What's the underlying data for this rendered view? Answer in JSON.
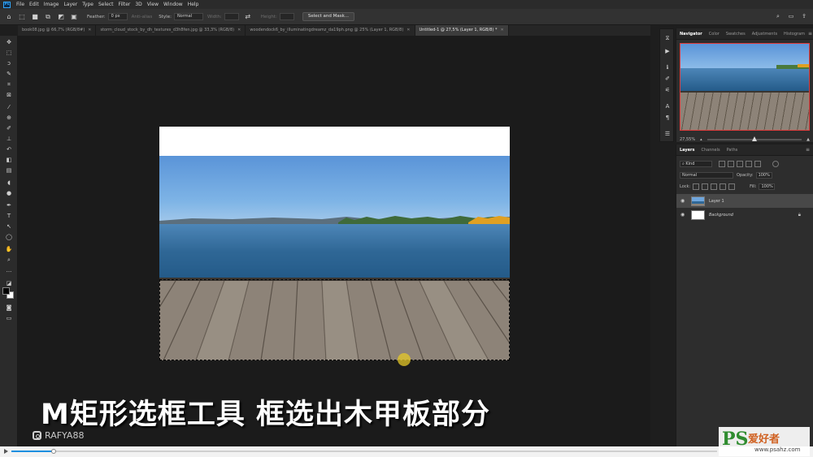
{
  "app": {
    "logo": "Ps"
  },
  "menu": [
    "File",
    "Edit",
    "Image",
    "Layer",
    "Type",
    "Select",
    "Filter",
    "3D",
    "View",
    "Window",
    "Help"
  ],
  "options": {
    "feather_label": "Feather:",
    "feather_value": "0 px",
    "antialias_label": "Anti-alias",
    "style_label": "Style:",
    "style_value": "Normal",
    "width_label": "Width:",
    "height_label": "Height:",
    "select_mask_button": "Select and Mask..."
  },
  "tabs": [
    {
      "label": "book08.jpg @ 66,7% (RGB/8#)"
    },
    {
      "label": "storm_cloud_stock_by_dh_textures_d3h8fen.jpg @ 33,3% (RGB/8)"
    },
    {
      "label": "woodendock6_by_illuminatingdreamz_da19ph.png @ 25% (Layer 1, RGB/8)"
    },
    {
      "label": "Untitled-1 @ 27,5% (Layer 1, RGB/8) *"
    }
  ],
  "caption": "M矩形选框工具 框选出木甲板部分",
  "watermark_user": "RAFYA88",
  "navigator": {
    "tabs": [
      "Navigator",
      "Color",
      "Swatches",
      "Adjustments",
      "Histogram"
    ],
    "zoom": "27,55%",
    "zoom_fraction": 0.5
  },
  "layers_panel": {
    "tabs": [
      "Layers",
      "Channels",
      "Paths"
    ],
    "filter_label": "Kind",
    "blend_mode": "Normal",
    "opacity_label": "Opacity:",
    "opacity_value": "100%",
    "lock_label": "Lock:",
    "fill_label": "Fill:",
    "fill_value": "100%",
    "layers": [
      {
        "name": "Layer 1",
        "selected": true
      },
      {
        "name": "Background",
        "selected": false
      }
    ]
  },
  "video": {
    "progress_fraction": 0.06
  },
  "site_badge": {
    "ps": "PS",
    "cn": "爱好者",
    "url": "www.psahz.com"
  },
  "colors": {
    "selection_accent": "#e03c3c",
    "progress": "#1a8fe0",
    "cursor_highlight": "#e6c828"
  }
}
